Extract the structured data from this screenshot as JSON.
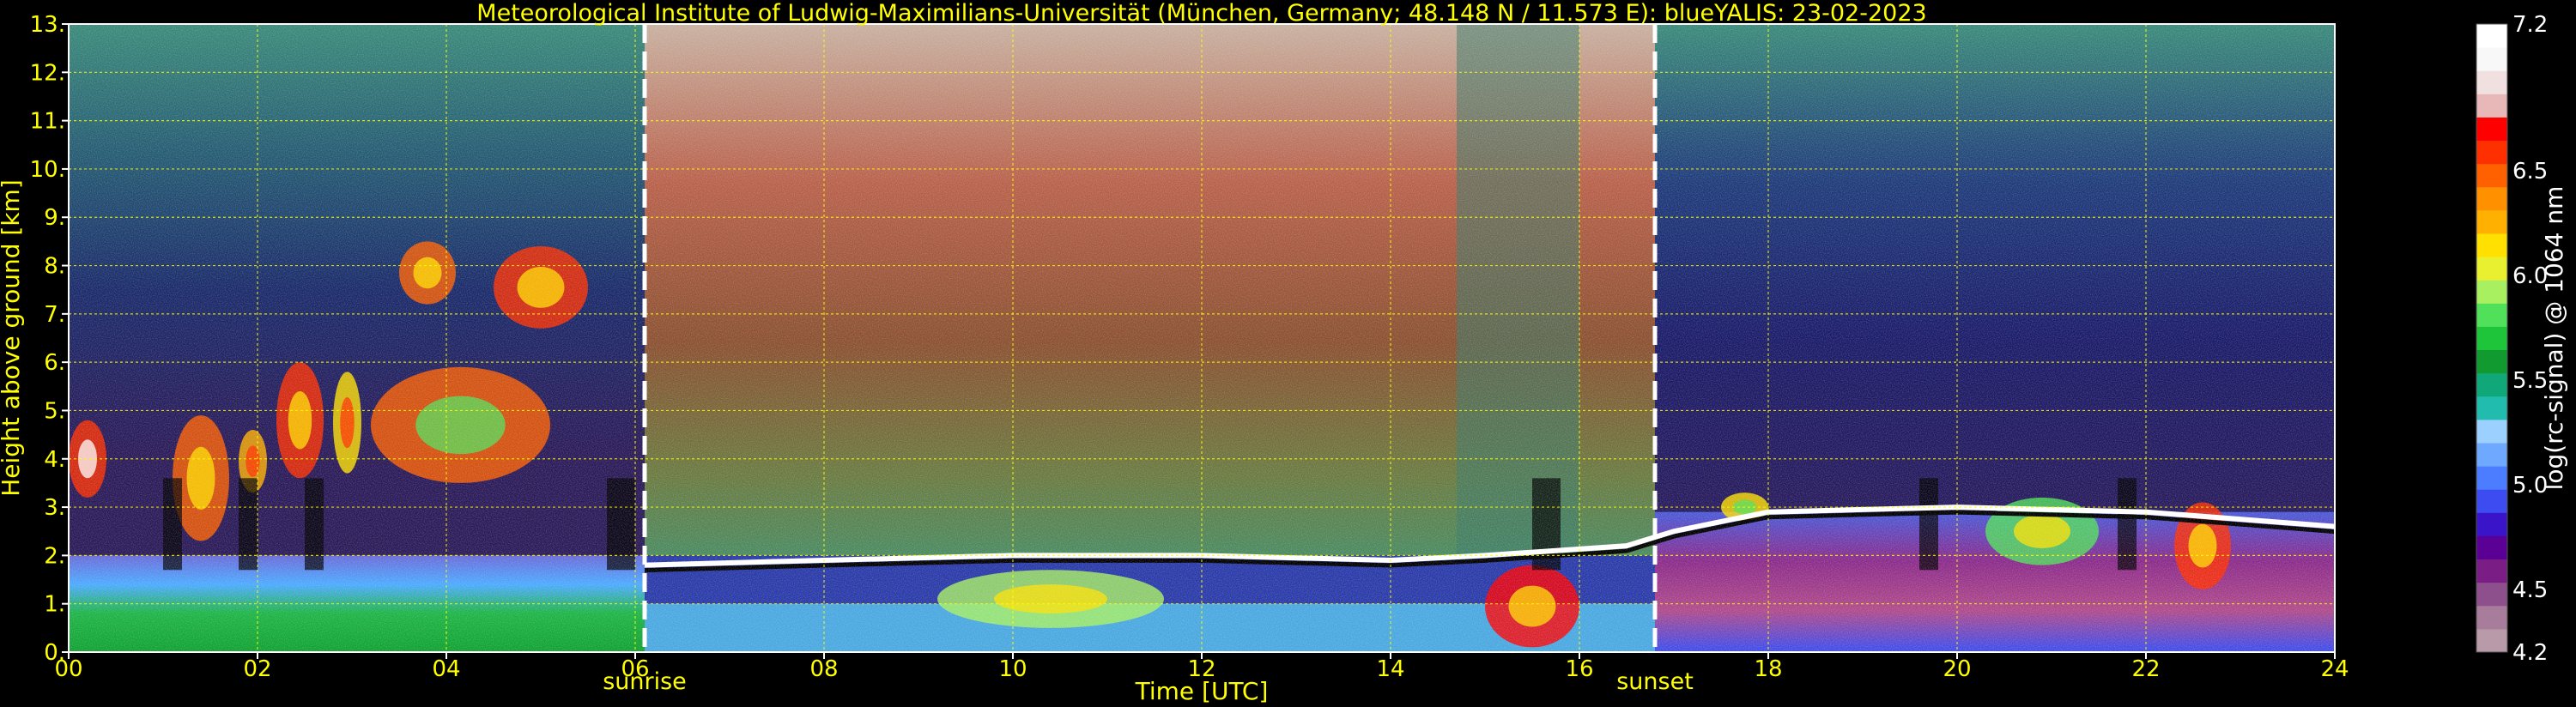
{
  "chart_data": {
    "type": "heatmap",
    "title": "Meteorological Institute of Ludwig-Maximilians-Universität (München, Germany; 48.148 N / 11.573 E):    blueYALIS: 23-02-2023",
    "xlabel": "Time [UTC]",
    "ylabel": "Height above ground [km]",
    "xlim": [
      0,
      24
    ],
    "ylim": [
      0,
      13
    ],
    "x_ticks": [
      "00",
      "02",
      "04",
      "06",
      "08",
      "10",
      "12",
      "14",
      "16",
      "18",
      "20",
      "22",
      "24"
    ],
    "y_ticks": [
      "0.",
      "1.",
      "2.",
      "3.",
      "4.",
      "5.",
      "6.",
      "7.",
      "8.",
      "9.",
      "10.",
      "11.",
      "12.",
      "13."
    ],
    "grid": true,
    "colorbar": {
      "label": "log(rc-signal) @ 1064 nm",
      "range": [
        4.2,
        7.2
      ],
      "ticks": [
        "4.2",
        "4.5",
        "5.0",
        "5.5",
        "6.0",
        "6.5",
        "7.2"
      ],
      "tick_values": [
        4.2,
        4.5,
        5.0,
        5.5,
        6.0,
        6.5,
        7.2
      ],
      "colors": [
        "#b89aa8",
        "#a87d9c",
        "#8e4f8d",
        "#7a1e86",
        "#5a0095",
        "#3a14c8",
        "#3c4cf0",
        "#4c7cff",
        "#6fa8ff",
        "#9cd0ff",
        "#22bcae",
        "#10a878",
        "#109a30",
        "#1ec43a",
        "#50e05a",
        "#a8f060",
        "#e8f030",
        "#ffe000",
        "#ffb000",
        "#ff9000",
        "#ff6000",
        "#ff3000",
        "#ff0000",
        "#e8b8b8",
        "#f0e0e0",
        "#f8f8f8",
        "#ffffff"
      ]
    },
    "events": [
      {
        "label": "sunrise",
        "x": 6.1
      },
      {
        "label": "sunset",
        "x": 16.8
      }
    ]
  }
}
